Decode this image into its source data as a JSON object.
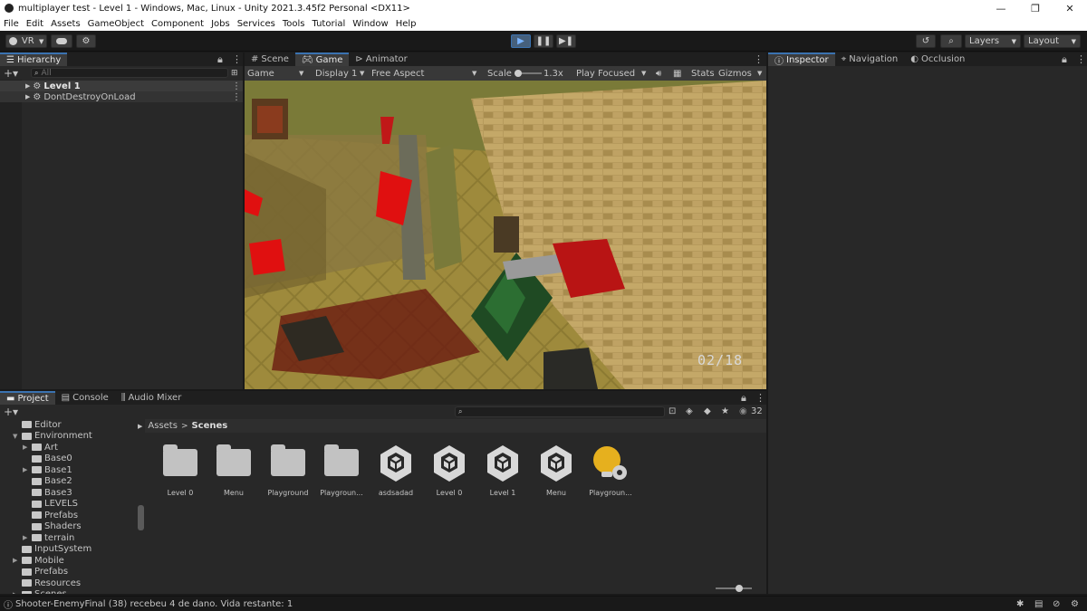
{
  "window": {
    "title": "multiplayer test - Level 1 - Windows, Mac, Linux - Unity 2021.3.45f2 Personal <DX11>"
  },
  "menu": [
    "File",
    "Edit",
    "Assets",
    "GameObject",
    "Component",
    "Jobs",
    "Services",
    "Tools",
    "Tutorial",
    "Window",
    "Help"
  ],
  "toolbar": {
    "vr_label": "VR",
    "layers_label": "Layers",
    "layout_label": "Layout"
  },
  "hierarchy": {
    "tab": "Hierarchy",
    "search_placeholder": "All",
    "items": [
      {
        "label": "Level 1"
      },
      {
        "label": "DontDestroyOnLoad"
      }
    ]
  },
  "center_tabs": [
    "Scene",
    "Game",
    "Animator"
  ],
  "game_bar": {
    "game_label": "Game",
    "display": "Display 1",
    "aspect": "Free Aspect",
    "scale_label": "Scale",
    "scale_value": "1.3x",
    "play_mode": "Play Focused",
    "stats": "Stats",
    "gizmos": "Gizmos"
  },
  "game_view": {
    "hud_counter": "02/18"
  },
  "right_tabs": [
    "Inspector",
    "Navigation",
    "Occlusion"
  ],
  "bottom_tabs": [
    "Project",
    "Console",
    "Audio Mixer"
  ],
  "project_tree": [
    {
      "label": "Editor",
      "indent": 1,
      "arrow": false
    },
    {
      "label": "Environment",
      "indent": 1,
      "arrow": "open"
    },
    {
      "label": "Art",
      "indent": 2,
      "arrow": "closed"
    },
    {
      "label": "Base0",
      "indent": 2,
      "arrow": false
    },
    {
      "label": "Base1",
      "indent": 2,
      "arrow": "closed"
    },
    {
      "label": "Base2",
      "indent": 2,
      "arrow": false
    },
    {
      "label": "Base3",
      "indent": 2,
      "arrow": false
    },
    {
      "label": "LEVELS",
      "indent": 2,
      "arrow": false
    },
    {
      "label": "Prefabs",
      "indent": 2,
      "arrow": false
    },
    {
      "label": "Shaders",
      "indent": 2,
      "arrow": false
    },
    {
      "label": "terrain",
      "indent": 2,
      "arrow": "closed"
    },
    {
      "label": "InputSystem",
      "indent": 1,
      "arrow": false
    },
    {
      "label": "Mobile",
      "indent": 1,
      "arrow": "closed"
    },
    {
      "label": "Prefabs",
      "indent": 1,
      "arrow": false
    },
    {
      "label": "Resources",
      "indent": 1,
      "arrow": false
    },
    {
      "label": "Scenes",
      "indent": 1,
      "arrow": "closed"
    }
  ],
  "breadcrumb": {
    "root": "Assets",
    "current": "Scenes"
  },
  "asset_count": "32",
  "assets": [
    {
      "label": "Level 0",
      "kind": "folder"
    },
    {
      "label": "Menu",
      "kind": "folder"
    },
    {
      "label": "Playground",
      "kind": "folder"
    },
    {
      "label": "Playgroun...",
      "kind": "folder"
    },
    {
      "label": "asdsadad",
      "kind": "unity-scene"
    },
    {
      "label": "Level 0",
      "kind": "unity-scene"
    },
    {
      "label": "Level 1",
      "kind": "unity-scene"
    },
    {
      "label": "Menu",
      "kind": "unity-scene"
    },
    {
      "label": "Playgroun...",
      "kind": "lighting-settings"
    }
  ],
  "status": {
    "message": "Shooter-EnemyFinal (38) recebeu 4 de dano. Vida restante: 1"
  }
}
